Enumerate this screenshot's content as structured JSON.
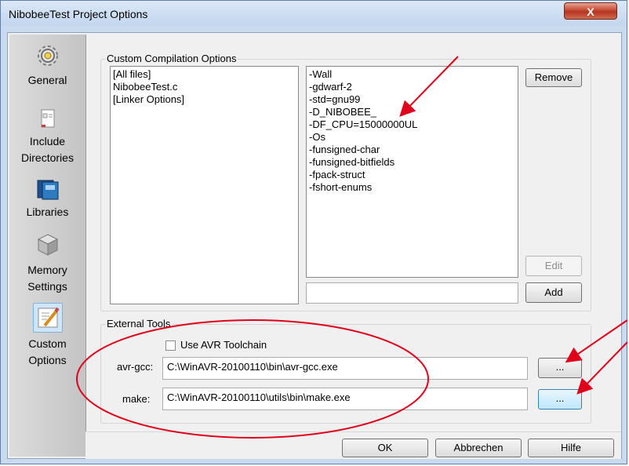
{
  "window": {
    "title": "NibobeeTest Project Options",
    "close_label": "X"
  },
  "nav": [
    {
      "label": "General",
      "icon": "gear-icon"
    },
    {
      "label": "Include Directories",
      "icon": "include-directories-icon"
    },
    {
      "label": "Libraries",
      "icon": "libraries-icon"
    },
    {
      "label": "Memory Settings",
      "icon": "memory-settings-icon"
    },
    {
      "label": "Custom Options",
      "icon": "custom-options-icon",
      "selected": true
    }
  ],
  "custom_compilation": {
    "group_label": "Custom Compilation Options",
    "files": [
      "[All files]",
      "NibobeeTest.c",
      "[Linker Options]"
    ],
    "options": [
      "-Wall",
      "-gdwarf-2",
      "-std=gnu99",
      "-D_NIBOBEE_",
      "-DF_CPU=15000000UL",
      "-Os",
      "-funsigned-char",
      "-funsigned-bitfields",
      "-fpack-struct",
      "-fshort-enums"
    ],
    "remove_label": "Remove",
    "edit_label": "Edit",
    "add_label": "Add",
    "new_option_value": ""
  },
  "external_tools": {
    "group_label": "External Tools",
    "use_avr_toolchain_label": "Use AVR Toolchain",
    "use_avr_toolchain_checked": false,
    "avr_gcc_label": "avr-gcc:",
    "avr_gcc_path": "C:\\WinAVR-20100110\\bin\\avr-gcc.exe",
    "make_label": "make:",
    "make_path": "C:\\WinAVR-20100110\\utils\\bin\\make.exe",
    "browse_label": "..."
  },
  "footer": {
    "ok_label": "OK",
    "cancel_label": "Abbrechen",
    "help_label": "Hilfe"
  },
  "annotation_color": "#e0001b"
}
